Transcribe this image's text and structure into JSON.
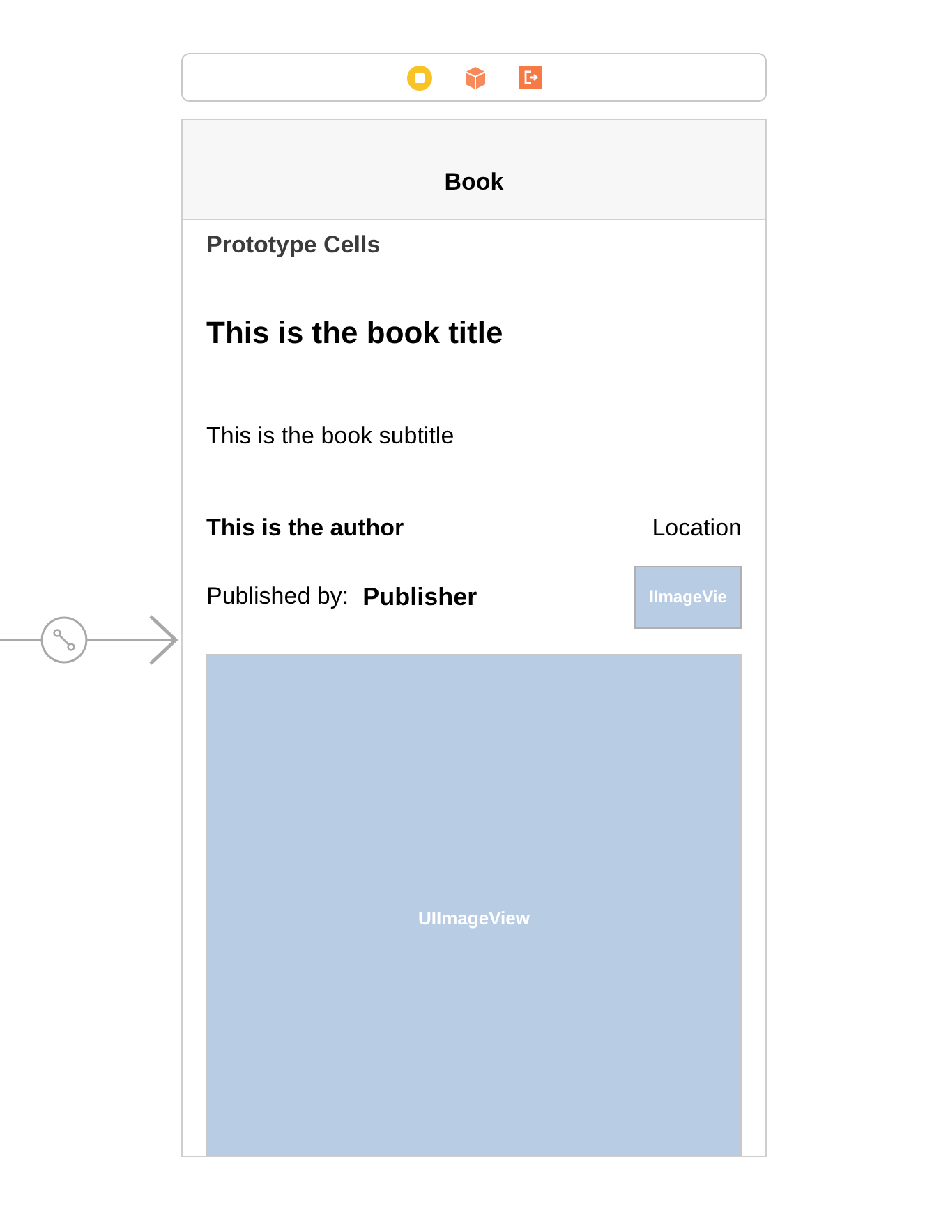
{
  "navigation_bar": {
    "title": "Book"
  },
  "table": {
    "section_header": "Prototype Cells",
    "cell": {
      "title": "This is the book title",
      "subtitle": "This is the book subtitle",
      "author": "This is the author",
      "location": "Location",
      "published_label": "Published by:",
      "publisher": "Publisher",
      "thumbnail_label": "IImageVie",
      "image_label": "UIImageView"
    }
  }
}
